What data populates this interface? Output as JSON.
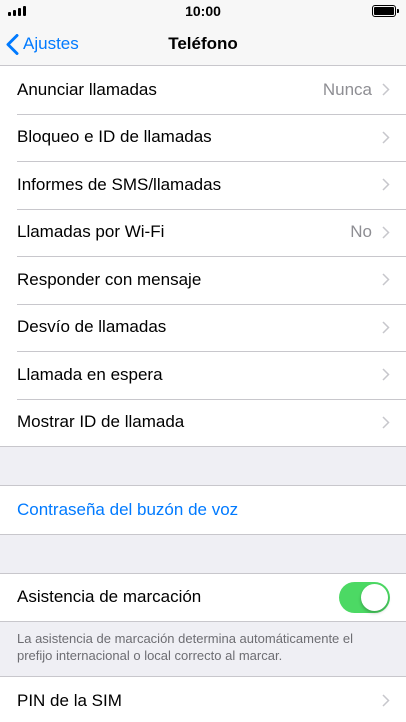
{
  "status_bar": {
    "time": "10:00"
  },
  "nav": {
    "back_label": "Ajustes",
    "title": "Teléfono"
  },
  "group1": {
    "items": [
      {
        "label": "Anunciar llamadas",
        "value": "Nunca"
      },
      {
        "label": "Bloqueo e ID de llamadas",
        "value": ""
      },
      {
        "label": "Informes de SMS/llamadas",
        "value": ""
      },
      {
        "label": "Llamadas por Wi-Fi",
        "value": "No"
      },
      {
        "label": "Responder con mensaje",
        "value": ""
      },
      {
        "label": "Desvío de llamadas",
        "value": ""
      },
      {
        "label": "Llamada en espera",
        "value": ""
      },
      {
        "label": "Mostrar ID de llamada",
        "value": ""
      }
    ]
  },
  "group2": {
    "voicemail_password": "Contraseña del buzón de voz"
  },
  "group3": {
    "dial_assist_label": "Asistencia de marcación",
    "dial_assist_on": true,
    "footer": "La asistencia de marcación determina automáticamente el prefijo internacional o local correcto al marcar."
  },
  "group4": {
    "sim_pin_label": "PIN de la SIM"
  },
  "colors": {
    "accent": "#007aff",
    "toggle_on": "#4cd964"
  },
  "icons": {
    "back": "chevron-left-icon",
    "disclosure": "chevron-right-icon"
  }
}
